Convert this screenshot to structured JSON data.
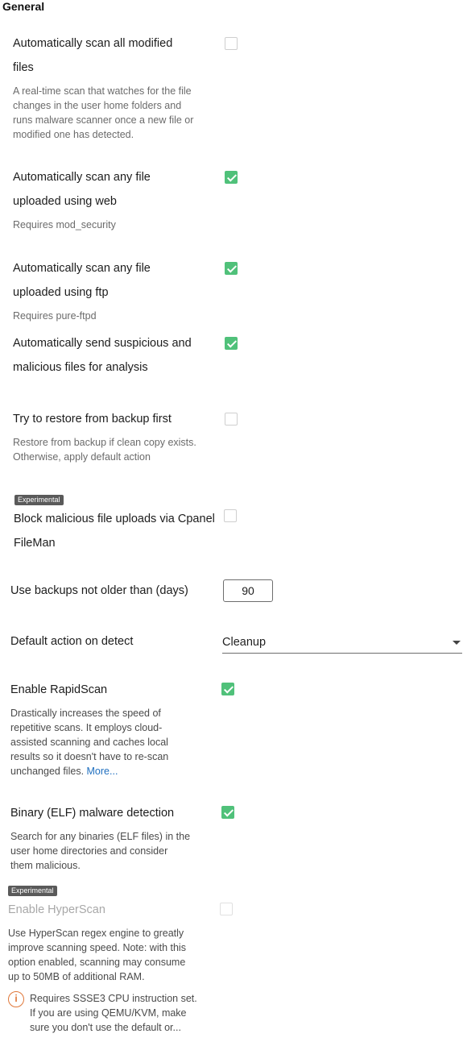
{
  "section_title": "General",
  "settings": {
    "scan_modified": {
      "label_line1": "Automatically scan all modified",
      "label_line2": "files",
      "desc_lines": [
        "A real-time scan that watches for the file",
        "changes in the user home folders and",
        "runs malware scanner once a new file or",
        "modified one has detected."
      ],
      "checked": false
    },
    "scan_web": {
      "label_line1": "Automatically scan any file",
      "label_line2": "uploaded using web",
      "desc": "Requires mod_security",
      "checked": true
    },
    "scan_ftp": {
      "label_line1": "Automatically scan any file",
      "label_line2": "uploaded using ftp",
      "desc": "Requires pure-ftpd",
      "checked": true
    },
    "send_suspicious": {
      "label_line1": "Automatically send suspicious and",
      "label_line2": "malicious files for analysis",
      "checked": true
    },
    "restore_backup": {
      "label": "Try to restore from backup first",
      "desc_lines": [
        "Restore from backup if clean copy exists.",
        "Otherwise, apply default action"
      ],
      "checked": false
    },
    "block_fileman": {
      "badge": "Experimental",
      "label_line1": "Block malicious file uploads via Cpanel",
      "label_line2": "FileMan",
      "checked": false
    },
    "backup_days": {
      "label": "Use backups not older than (days)",
      "value": "90"
    },
    "default_action": {
      "label": "Default action on detect",
      "selected": "Cleanup"
    },
    "rapidscan": {
      "label": "Enable RapidScan",
      "desc_lines": [
        "Drastically increases the speed of",
        "repetitive scans. It employs cloud-",
        "assisted scanning and caches local",
        "results so it doesn't have to re-scan"
      ],
      "desc_last": "unchanged files. ",
      "more_link": "More...",
      "checked": true
    },
    "elf_detection": {
      "label": "Binary (ELF) malware detection",
      "desc_lines": [
        "Search for any binaries (ELF files) in the",
        "user home directories and consider",
        "them malicious."
      ],
      "checked": true
    },
    "hyperscan": {
      "badge": "Experimental",
      "label": "Enable HyperScan",
      "desc_lines": [
        "Use HyperScan regex engine to greatly",
        "improve scanning speed. Note: with this",
        "option enabled, scanning may consume",
        "up to 50MB of additional RAM."
      ],
      "warning_lines": [
        "Requires SSSE3 CPU instruction set.",
        "If you are using QEMU/KVM, make",
        "sure you don't use the default or..."
      ],
      "warning_icon": "info-circle-icon",
      "checked": false,
      "disabled": true
    }
  },
  "colors": {
    "check_green": "#50c17a",
    "link_blue": "#1f6fbf",
    "warning_orange": "#e0783a"
  }
}
